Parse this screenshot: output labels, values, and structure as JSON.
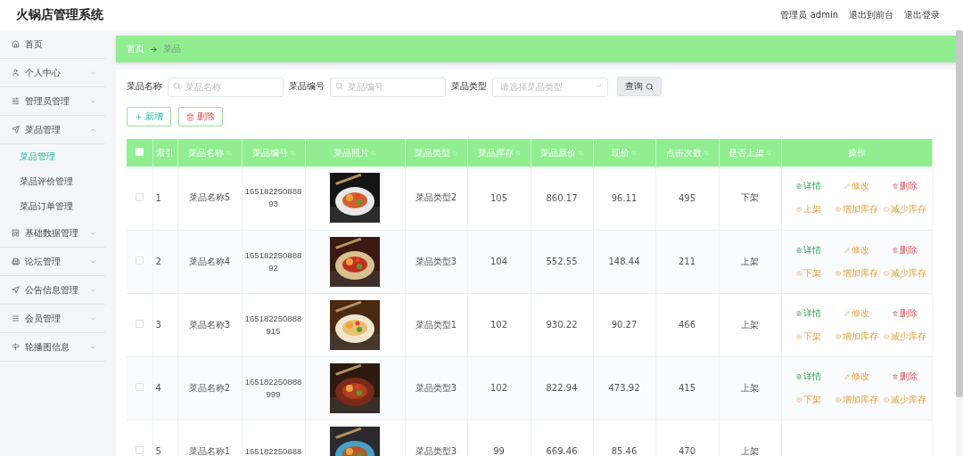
{
  "app": {
    "title": "火锅店管理系统"
  },
  "header_links": [
    "管理员 admin",
    "退出到前台",
    "退出登录"
  ],
  "sidebar": {
    "items": [
      {
        "label": "首页"
      },
      {
        "label": "个人中心",
        "expanded": false
      },
      {
        "label": "管理员管理",
        "expanded": false
      },
      {
        "label": "菜品管理",
        "expanded": true,
        "children": [
          {
            "label": "菜品管理",
            "selected": true
          },
          {
            "label": "菜品评价管理",
            "selected": false
          },
          {
            "label": "菜品订单管理",
            "selected": false
          }
        ]
      },
      {
        "label": "基础数据管理",
        "expanded": false
      },
      {
        "label": "论坛管理",
        "expanded": false
      },
      {
        "label": "公告信息管理",
        "expanded": false
      },
      {
        "label": "会员管理",
        "expanded": false
      },
      {
        "label": "轮播图信息",
        "expanded": false
      }
    ]
  },
  "breadcrumb": [
    "首页",
    "菜品"
  ],
  "search": {
    "fields": [
      {
        "kind": "text",
        "label": "菜品名称",
        "placeholder": "菜品名称"
      },
      {
        "kind": "text",
        "label": "菜品编号",
        "placeholder": "菜品编号"
      },
      {
        "kind": "select",
        "label": "菜品类型",
        "placeholder": "请选择菜品类型"
      }
    ],
    "button": "查询"
  },
  "toolbar": {
    "add": "新增",
    "delete": "删除"
  },
  "table": {
    "header_checkbox": {
      "checked": false
    },
    "columns": [
      {
        "label": "索引",
        "sortable": false
      },
      {
        "label": "菜品名称",
        "sortable": true
      },
      {
        "label": "菜品编号",
        "sortable": true
      },
      {
        "label": "菜品照片",
        "sortable": true
      },
      {
        "label": "菜品类型",
        "sortable": true
      },
      {
        "label": "菜品库存",
        "sortable": true
      },
      {
        "label": "菜品原价",
        "sortable": true
      },
      {
        "label": "现价",
        "sortable": true
      },
      {
        "label": "点击次数",
        "sortable": true
      },
      {
        "label": "是否上架",
        "sortable": true
      },
      {
        "label": "操作",
        "sortable": false
      }
    ],
    "rows": [
      {
        "checked": false,
        "index": "1",
        "name": "菜品名称5",
        "code": "16518225088893",
        "type": "菜品类型2",
        "stock": "105",
        "price": "860.17",
        "sale_price": "96.11",
        "clicks": "495",
        "status": "下架",
        "actions": [
          {
            "kind": "detail",
            "label": "详情"
          },
          {
            "kind": "edit",
            "label": "修改"
          },
          {
            "kind": "delete",
            "label": "删除"
          },
          {
            "kind": "shelf",
            "label": "上架"
          },
          {
            "kind": "add_stock",
            "label": "增加库存"
          },
          {
            "kind": "reduce_stock",
            "label": "减少库存"
          }
        ]
      },
      {
        "checked": false,
        "index": "2",
        "name": "菜品名称4",
        "code": "16518225088892",
        "type": "菜品类型3",
        "stock": "104",
        "price": "552.55",
        "sale_price": "148.44",
        "clicks": "211",
        "status": "上架",
        "actions": [
          {
            "kind": "detail",
            "label": "详情"
          },
          {
            "kind": "edit",
            "label": "修改"
          },
          {
            "kind": "delete",
            "label": "删除"
          },
          {
            "kind": "shelf",
            "label": "下架"
          },
          {
            "kind": "add_stock",
            "label": "增加库存"
          },
          {
            "kind": "reduce_stock",
            "label": "减少库存"
          }
        ]
      },
      {
        "checked": false,
        "index": "3",
        "name": "菜品名称3",
        "code": "165182250888915",
        "type": "菜品类型1",
        "stock": "102",
        "price": "930.22",
        "sale_price": "90.27",
        "clicks": "466",
        "status": "上架",
        "actions": [
          {
            "kind": "detail",
            "label": "详情"
          },
          {
            "kind": "edit",
            "label": "修改"
          },
          {
            "kind": "delete",
            "label": "删除"
          },
          {
            "kind": "shelf",
            "label": "下架"
          },
          {
            "kind": "add_stock",
            "label": "增加库存"
          },
          {
            "kind": "reduce_stock",
            "label": "减少库存"
          }
        ]
      },
      {
        "checked": false,
        "index": "4",
        "name": "菜品名称2",
        "code": "165182250888999",
        "type": "菜品类型3",
        "stock": "102",
        "price": "822.94",
        "sale_price": "473.92",
        "clicks": "415",
        "status": "上架",
        "actions": [
          {
            "kind": "detail",
            "label": "详情"
          },
          {
            "kind": "edit",
            "label": "修改"
          },
          {
            "kind": "delete",
            "label": "删除"
          },
          {
            "kind": "shelf",
            "label": "下架"
          },
          {
            "kind": "add_stock",
            "label": "增加库存"
          },
          {
            "kind": "reduce_stock",
            "label": "减少库存"
          }
        ]
      },
      {
        "checked": false,
        "index": "5",
        "name": "菜品名称1",
        "code": "165182250888",
        "type": "菜品类型3",
        "stock": "99",
        "price": "669.46",
        "sale_price": "85.46",
        "clicks": "470",
        "status": "上架"
      }
    ]
  }
}
